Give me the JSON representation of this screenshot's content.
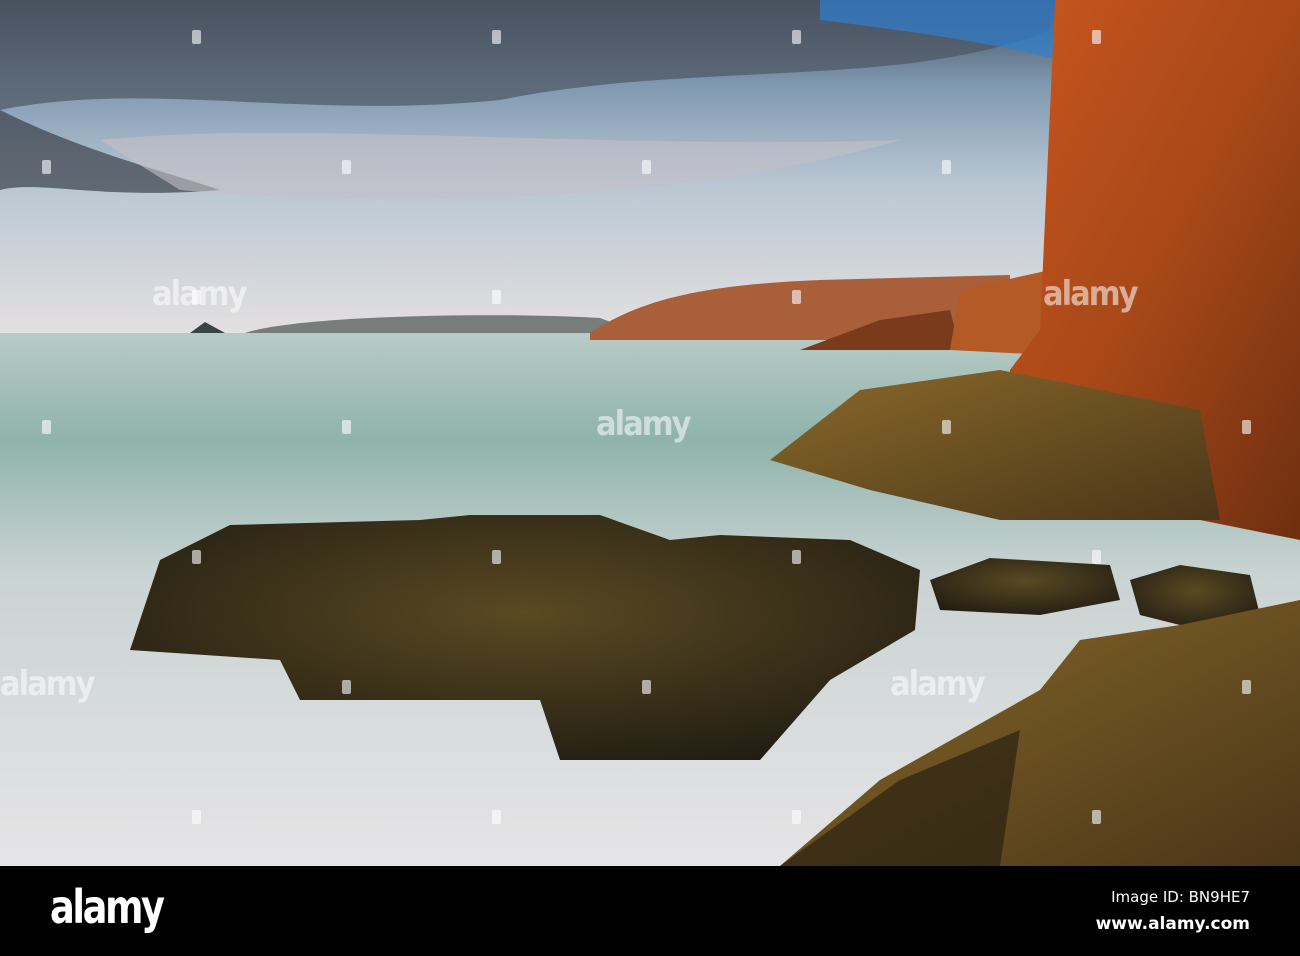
{
  "watermark": {
    "text": "alamy"
  },
  "footer": {
    "logo": "alamy",
    "image_id": "Image ID: BN9HE7",
    "website": "www.alamy.com"
  },
  "colors": {
    "sky": "#5a8fb8",
    "sea": "#c8d6d2",
    "cliff": "#b8541c",
    "rock": "#2a2418"
  }
}
